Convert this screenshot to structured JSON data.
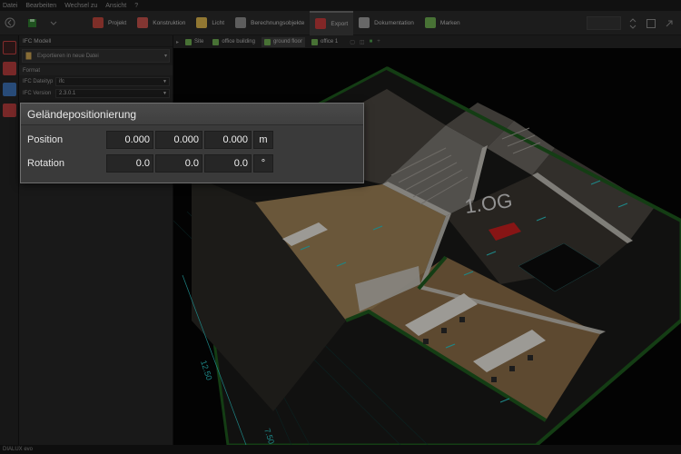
{
  "menu": [
    "Datei",
    "Bearbeiten",
    "Wechsel zu",
    "Ansicht",
    "?"
  ],
  "toolbar": {
    "tabs": [
      {
        "label": "Projekt",
        "color": "#b8443b",
        "active": false
      },
      {
        "label": "Konstruktion",
        "color": "#c0504a",
        "active": false
      },
      {
        "label": "Licht",
        "color": "#d6b04a",
        "active": false
      },
      {
        "label": "Berechnungsobjekte",
        "color": "#8a8a8a",
        "active": false
      },
      {
        "label": "Export",
        "color": "#c03a3a",
        "active": true
      },
      {
        "label": "Dokumentation",
        "color": "#9a9a9a",
        "active": false
      },
      {
        "label": "Marken",
        "color": "#6aa84f",
        "active": false
      }
    ]
  },
  "panel": {
    "title": "IFC Modell",
    "export_label": "Exportieren in neue Datei",
    "section_label": "Format",
    "properties": [
      {
        "label": "IFC Dateityp",
        "value": "ifc"
      },
      {
        "label": "IFC Version",
        "value": "2.3.0.1"
      }
    ]
  },
  "breadcrumb": [
    "Site",
    "office building",
    "ground floor",
    "office 1"
  ],
  "scene": {
    "floor_label": "1.OG",
    "dimension_labels": [
      "12.50",
      "7.50"
    ]
  },
  "dialog": {
    "title": "Geländepositionierung",
    "position_label": "Position",
    "position_values": [
      "0.000",
      "0.000",
      "0.000"
    ],
    "position_unit": "m",
    "rotation_label": "Rotation",
    "rotation_values": [
      "0.0",
      "0.0",
      "0.0"
    ],
    "rotation_unit": "°"
  },
  "status": "DIALUX evo",
  "colors": {
    "wall": "#1e5a1e",
    "interior_wall": "#c9c6bf",
    "floor": "#9d8056",
    "accent_red": "#c82020",
    "cyan_marks": "#2cc6c6"
  }
}
